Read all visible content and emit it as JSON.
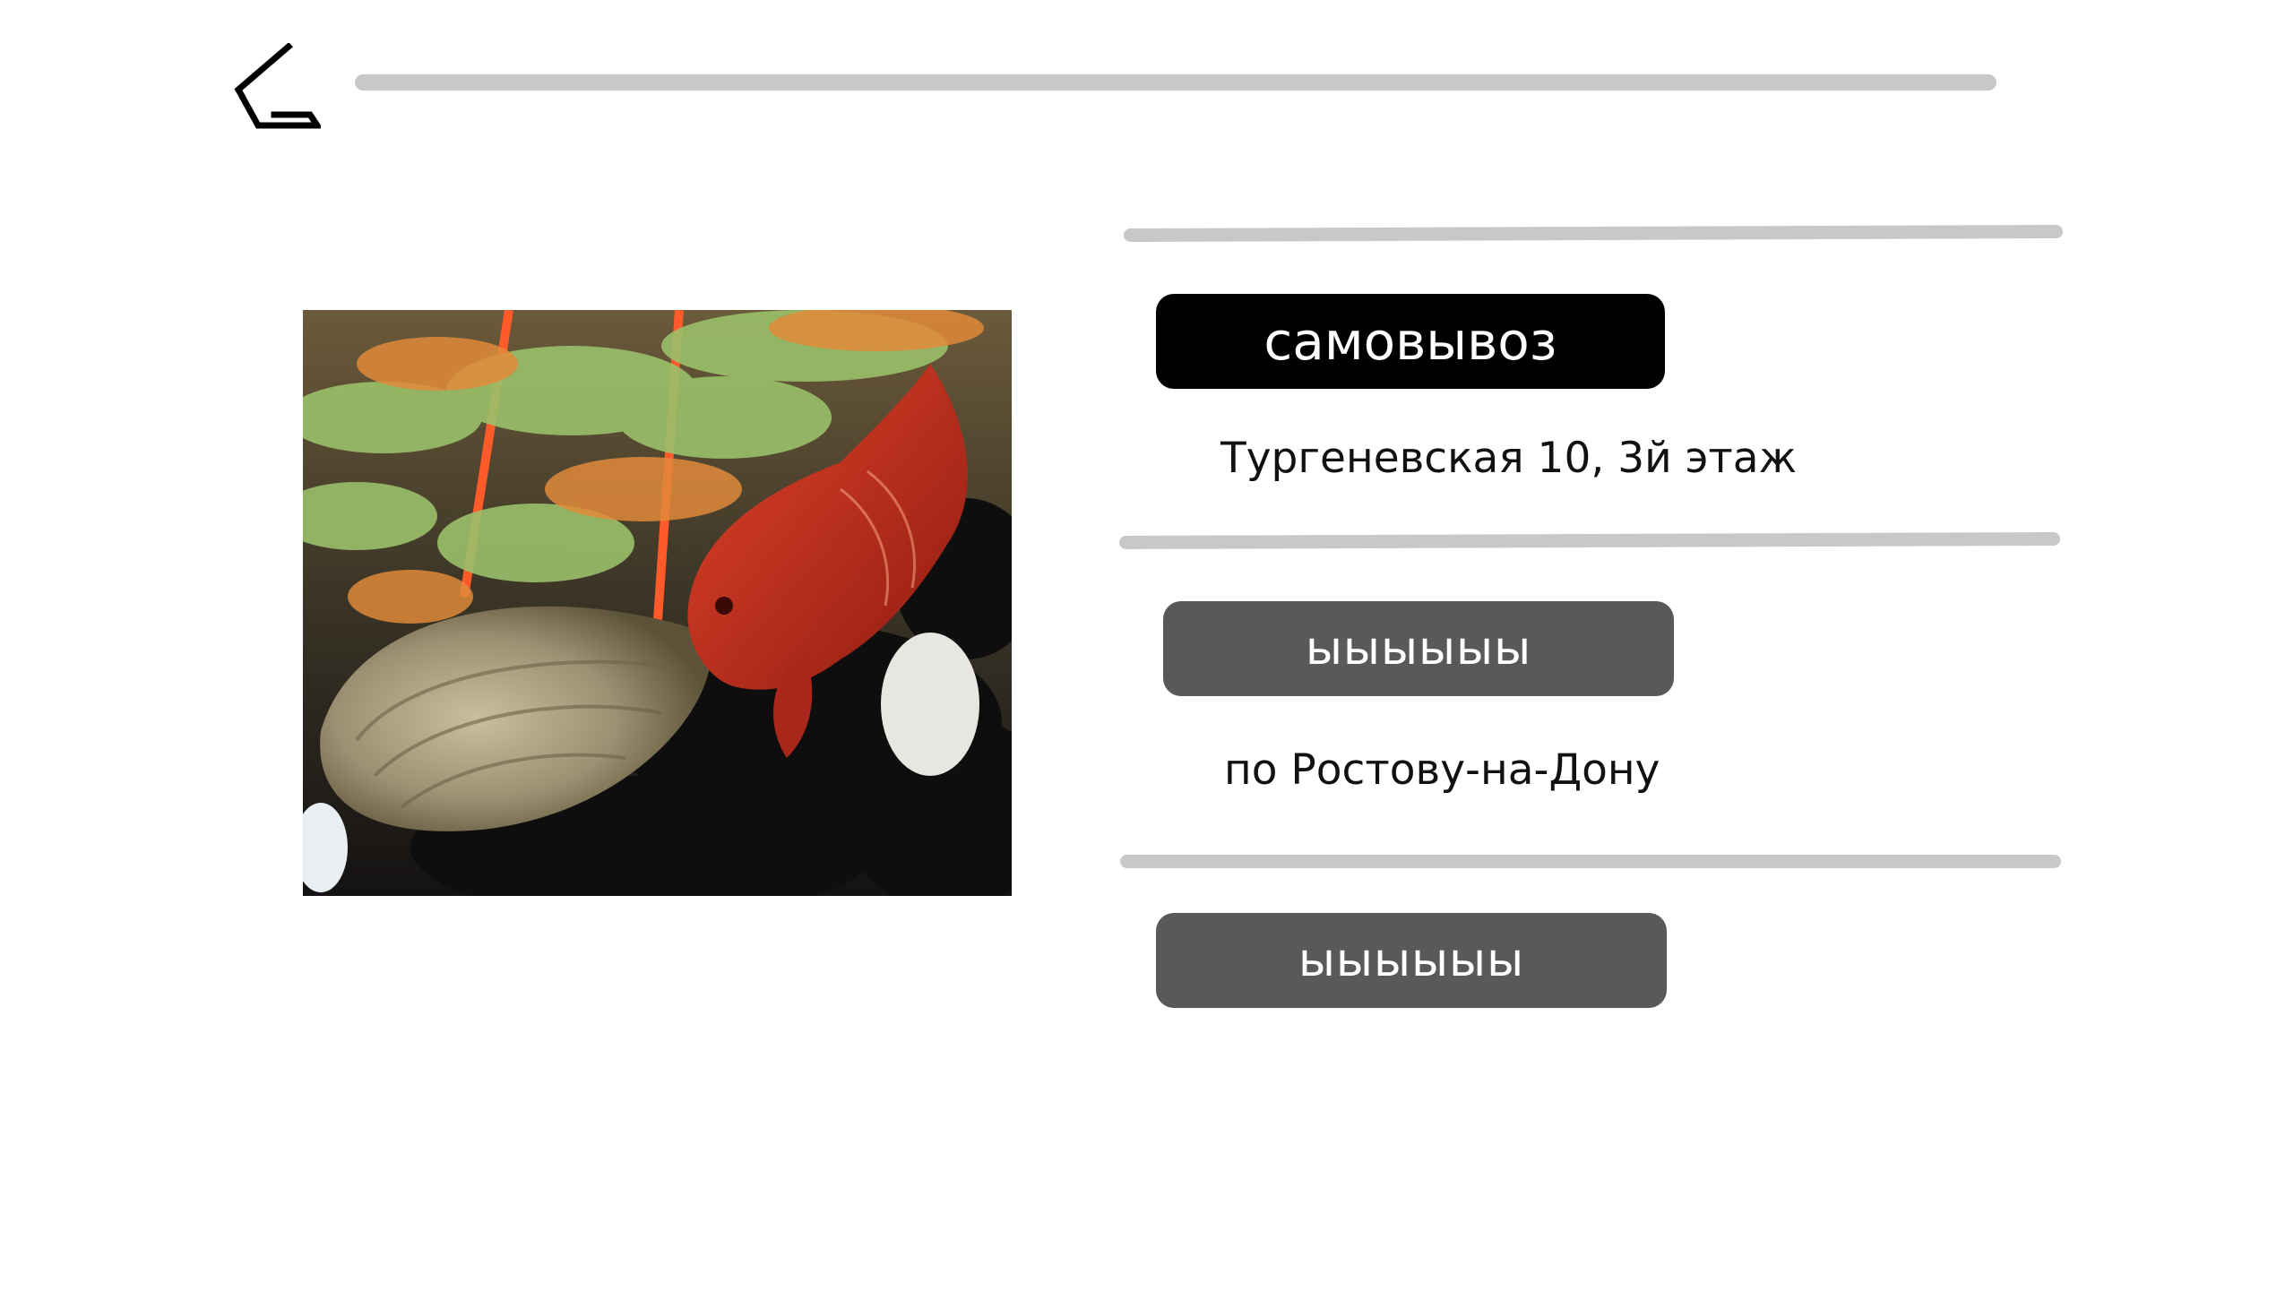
{
  "header": {
    "back_icon": "back-arrow-icon"
  },
  "product": {
    "image_desc_icon": "photo"
  },
  "delivery": {
    "options": [
      {
        "label": "самовывоз",
        "note": "Тургеневская 10, 3й этаж"
      },
      {
        "label": "ыыыыыы",
        "note": "по Ростову-на-Дону"
      },
      {
        "label": "ыыыыыы"
      }
    ]
  },
  "colors": {
    "selected_pill": "#000000",
    "unselected_pill": "#595959",
    "divider": "#c8c8c8"
  }
}
